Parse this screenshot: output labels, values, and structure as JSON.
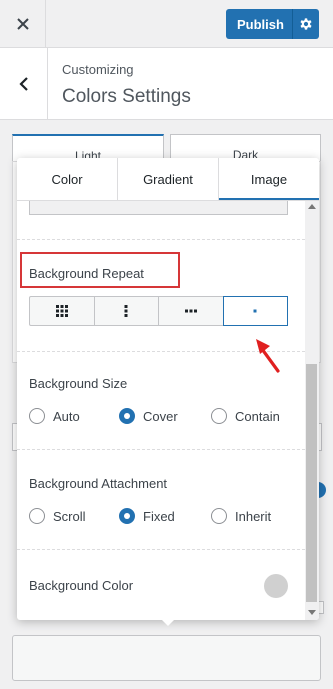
{
  "header": {
    "close_icon": "close-icon",
    "publish_label": "Publish",
    "gear_icon": "gear-icon"
  },
  "breadcrumb": {
    "subtitle": "Customizing",
    "title": "Colors Settings"
  },
  "background_tabs": [
    "Light",
    "Dark"
  ],
  "popup": {
    "tabs": [
      {
        "label": "Color",
        "active": false
      },
      {
        "label": "Gradient",
        "active": false
      },
      {
        "label": "Image",
        "active": true
      }
    ],
    "background_repeat": {
      "label": "Background Repeat",
      "options": [
        "repeat",
        "repeat-y",
        "repeat-x",
        "no-repeat"
      ],
      "selected": "no-repeat"
    },
    "background_size": {
      "label": "Background Size",
      "options": [
        "Auto",
        "Cover",
        "Contain"
      ],
      "selected": "Cover"
    },
    "background_attachment": {
      "label": "Background Attachment",
      "options": [
        "Scroll",
        "Fixed",
        "Inherit"
      ],
      "selected": "Fixed"
    },
    "background_color": {
      "label": "Background Color",
      "value": "#d0d0d0"
    }
  },
  "colors": {
    "accent": "#2271b1",
    "highlight": "#d63638"
  }
}
